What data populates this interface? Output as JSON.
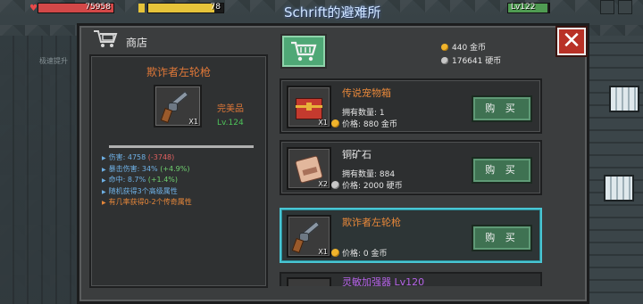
{
  "hud": {
    "hp_value": "75958",
    "hp_fraction": 1.0,
    "energy_value": "78",
    "energy_fraction": 0.88,
    "location_title": "Schrift的避难所",
    "level_label": "Lv122",
    "level_fraction": 0.95
  },
  "background": {
    "speed_hint": "极速提升"
  },
  "panel": {
    "title": "商店",
    "shop_tab_icon": "cart-icon",
    "close_icon": "close-icon"
  },
  "currency": {
    "gold": "440 金币",
    "silver": "176641 硬币"
  },
  "detail": {
    "name": "欺诈者左轮枪",
    "quality": "完美品",
    "level": "Lv.124",
    "slot_count": "X1",
    "stats": [
      {
        "label": "伤害: 4758 ",
        "delta": "(-3748)",
        "delta_color": "red"
      },
      {
        "label": "暴击伤害: 34% ",
        "delta": "(+4.9%)",
        "delta_color": "green"
      },
      {
        "label": "命中: 8.7% ",
        "delta": "(+1.4%)",
        "delta_color": "green"
      },
      {
        "label": "随机获得3个高级属性",
        "delta": "",
        "delta_color": ""
      },
      {
        "label": "有几率获得0-2个传奇属性",
        "delta": "",
        "delta_color": "orange"
      }
    ]
  },
  "shop": {
    "buy_label": "购 买",
    "items": [
      {
        "name": "传说宠物箱",
        "owned": "拥有数量: 1",
        "price": "价格: 880 金币",
        "currency": "gold",
        "slot_count": "X1",
        "icon": "pet-chest-icon"
      },
      {
        "name": "铜矿石",
        "owned": "拥有数量: 884",
        "price": "价格: 2000 硬币",
        "currency": "silver",
        "slot_count": "X2",
        "icon": "copper-ore-icon"
      },
      {
        "name": "欺诈者左轮枪",
        "owned": "",
        "price": "价格: 0 金币",
        "currency": "gold",
        "slot_count": "X1",
        "icon": "revolver-icon"
      }
    ],
    "partial_item_name": "灵敏加强器 Lv120"
  },
  "colors": {
    "accent_orange": "#e8883a",
    "buy_green": "#3f7252",
    "close_red": "#b93126",
    "selected_cyan": "#49c6d4",
    "stat_blue": "#6fb1e6"
  }
}
